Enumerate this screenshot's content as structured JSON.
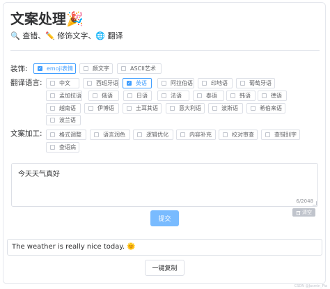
{
  "header": {
    "title": "文案处理",
    "title_emoji": "🎉",
    "subtitle_icon_1": "🔍",
    "subtitle_part_1": "查错、",
    "subtitle_icon_2": "✏️",
    "subtitle_part_2": "修饰文字、",
    "subtitle_icon_3": "🌐",
    "subtitle_part_3": "翻译"
  },
  "decoration": {
    "label": "装饰:",
    "options": [
      {
        "label": "emoji表情",
        "checked": true
      },
      {
        "label": "颜文字",
        "checked": false
      },
      {
        "label": "ASCII艺术",
        "checked": false
      }
    ]
  },
  "translate": {
    "label": "翻译语言:",
    "options": [
      {
        "label": "中文",
        "checked": false
      },
      {
        "label": "西班牙语",
        "checked": false
      },
      {
        "label": "英语",
        "checked": true
      },
      {
        "label": "阿拉伯语",
        "checked": false
      },
      {
        "label": "印地语",
        "checked": false
      },
      {
        "label": "葡萄牙语",
        "checked": false
      },
      {
        "label": "孟加拉语",
        "checked": false
      },
      {
        "label": "俄语",
        "checked": false
      },
      {
        "label": "日语",
        "checked": false
      },
      {
        "label": "法语",
        "checked": false
      },
      {
        "label": "泰语",
        "checked": false
      },
      {
        "label": "韩语",
        "checked": false
      },
      {
        "label": "德语",
        "checked": false
      },
      {
        "label": "越南语",
        "checked": false
      },
      {
        "label": "伊博语",
        "checked": false
      },
      {
        "label": "土耳其语",
        "checked": false
      },
      {
        "label": "意大利语",
        "checked": false
      },
      {
        "label": "波斯语",
        "checked": false
      },
      {
        "label": "希伯来语",
        "checked": false
      },
      {
        "label": "波兰语",
        "checked": false
      }
    ]
  },
  "processing": {
    "label": "文案加工:",
    "options": [
      {
        "label": "格式调整",
        "checked": false
      },
      {
        "label": "语言润色",
        "checked": false
      },
      {
        "label": "逻辑优化",
        "checked": false
      },
      {
        "label": "内容补充",
        "checked": false
      },
      {
        "label": "校对审查",
        "checked": false
      },
      {
        "label": "查错别字",
        "checked": false
      },
      {
        "label": "查语病",
        "checked": false
      }
    ]
  },
  "input": {
    "value": "今天天气真好",
    "count": "6/2048",
    "clear_label": "清空",
    "clear_icon": "trash-icon"
  },
  "submit_label": "提交",
  "result": {
    "text": "The weather is really nice today.",
    "emoji": "🌞"
  },
  "copy_label": "一键复制",
  "watermark": "CSDN @Jasmin_Pia",
  "colors": {
    "accent": "#409eff",
    "submit_bg": "#79bbff",
    "border": "#dcdfe6",
    "clear_bg": "#c0c4cc"
  }
}
